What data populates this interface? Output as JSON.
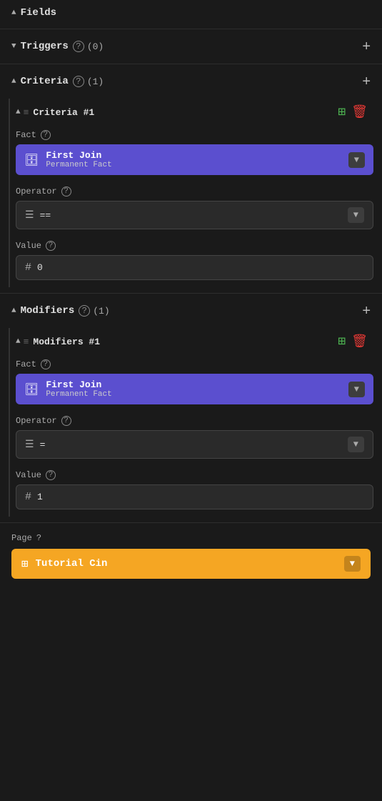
{
  "fields": {
    "label": "Fields"
  },
  "triggers": {
    "label": "Triggers",
    "count": "(0)",
    "add_label": "+"
  },
  "criteria": {
    "label": "Criteria",
    "count": "(1)",
    "add_label": "+",
    "items": [
      {
        "title": "Criteria #1",
        "fact_name": "First Join",
        "fact_type": "Permanent Fact",
        "operator_icon": "list",
        "operator": "==",
        "value": "0"
      }
    ]
  },
  "modifiers": {
    "label": "Modifiers",
    "count": "(1)",
    "add_label": "+",
    "items": [
      {
        "title": "Modifiers #1",
        "fact_name": "First Join",
        "fact_type": "Permanent Fact",
        "operator_icon": "list",
        "operator": "=",
        "value": "1"
      }
    ]
  },
  "page": {
    "label": "Page",
    "name": "Tutorial Cin"
  },
  "labels": {
    "fact": "Fact",
    "operator": "Operator",
    "value": "Value"
  }
}
